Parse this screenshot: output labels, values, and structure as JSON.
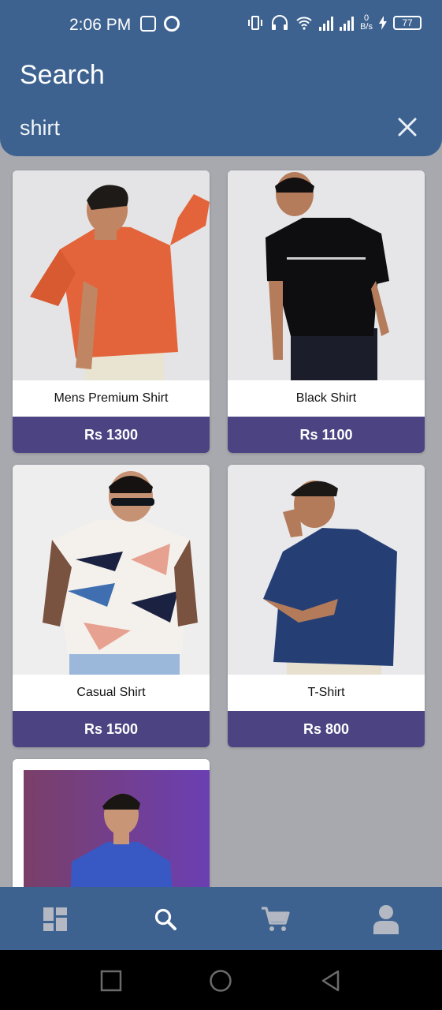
{
  "status_bar": {
    "time": "2:06 PM",
    "battery": "77",
    "net_speed_value": "0",
    "net_speed_unit": "B/s"
  },
  "header": {
    "title": "Search"
  },
  "search": {
    "value": "shirt",
    "placeholder": ""
  },
  "products": [
    {
      "name": "Mens Premium Shirt",
      "price": "Rs 1300"
    },
    {
      "name": "Black Shirt",
      "price": "Rs 1100"
    },
    {
      "name": "Casual Shirt",
      "price": "Rs 1500"
    },
    {
      "name": "T-Shirt",
      "price": "Rs 800"
    }
  ],
  "bottom_nav": {
    "items": [
      "dashboard-icon",
      "search-icon",
      "cart-icon",
      "profile-icon"
    ],
    "active": "search-icon"
  },
  "colors": {
    "header": "#3d6290",
    "price_bar": "#4b4382",
    "background": "#a7a9ae"
  }
}
